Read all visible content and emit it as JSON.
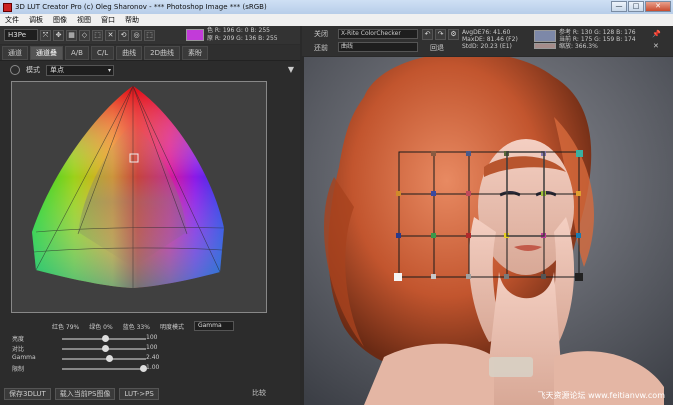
{
  "window": {
    "title": "3D LUT Creator Pro (c) Oleg Sharonov - *** Photoshop Image *** (sRGB)",
    "min": "—",
    "max": "□",
    "close": "✕"
  },
  "menu": [
    "文件",
    "调板",
    "图像",
    "视图",
    "窗口",
    "帮助"
  ],
  "left": {
    "preset": "H3Pe",
    "tools": [
      "⤧",
      "✥",
      "▦",
      "◇",
      "⬚",
      "✕",
      "⟲",
      "◎",
      "⬚"
    ],
    "readout": {
      "l1": "色   R: 196   G: 0     B: 255",
      "l2": "原   R: 209   G: 136   B: 255"
    },
    "tabs": [
      "通道",
      "通道叠",
      "A/B",
      "C/L",
      "曲线",
      "2D曲线",
      "素盼"
    ],
    "mode_label": "模式",
    "mode_value": "单点",
    "menu_arrow": "▼",
    "hue_row": {
      "red": "红色  79%",
      "green": "绿色  0%",
      "blue": "蓝色  33%",
      "brightness_mode": "明度模式",
      "gamma": "Gamma"
    },
    "sliders": [
      {
        "label": "亮度",
        "value": "100"
      },
      {
        "label": "对比",
        "value": "100"
      },
      {
        "label": "Gamma",
        "value": "2.40"
      },
      {
        "label": "限制",
        "value": "1.00"
      }
    ],
    "buttons": [
      "保存3DLUT",
      "载入当前PS图像",
      "LUT->PS"
    ],
    "compare": "比较"
  },
  "right": {
    "toolbar": {
      "close": "关闭",
      "checker": "X-Rite ColorChecker",
      "before": "还前",
      "curve_dd": "曲线",
      "restore": "回退",
      "undo": "↶",
      "redo": "↷",
      "fit": "⚙",
      "avg": "AvgDE76: 41.60",
      "max": "MaxDE: 81.46 (F2)",
      "std": "StdD: 20.23 (E1)",
      "rgb1": "参考 R: 130  G: 128  B: 176",
      "rgb2": "当前 R: 175  G: 159  B: 174",
      "zoom": "缩放: 366.3%",
      "pin": "📌",
      "close_btn": "✕"
    },
    "watermark": "飞天资源论坛 www.feitianvw.com"
  },
  "colors": {
    "accent": "#c23bd9",
    "panel": "#2c2c2c"
  }
}
